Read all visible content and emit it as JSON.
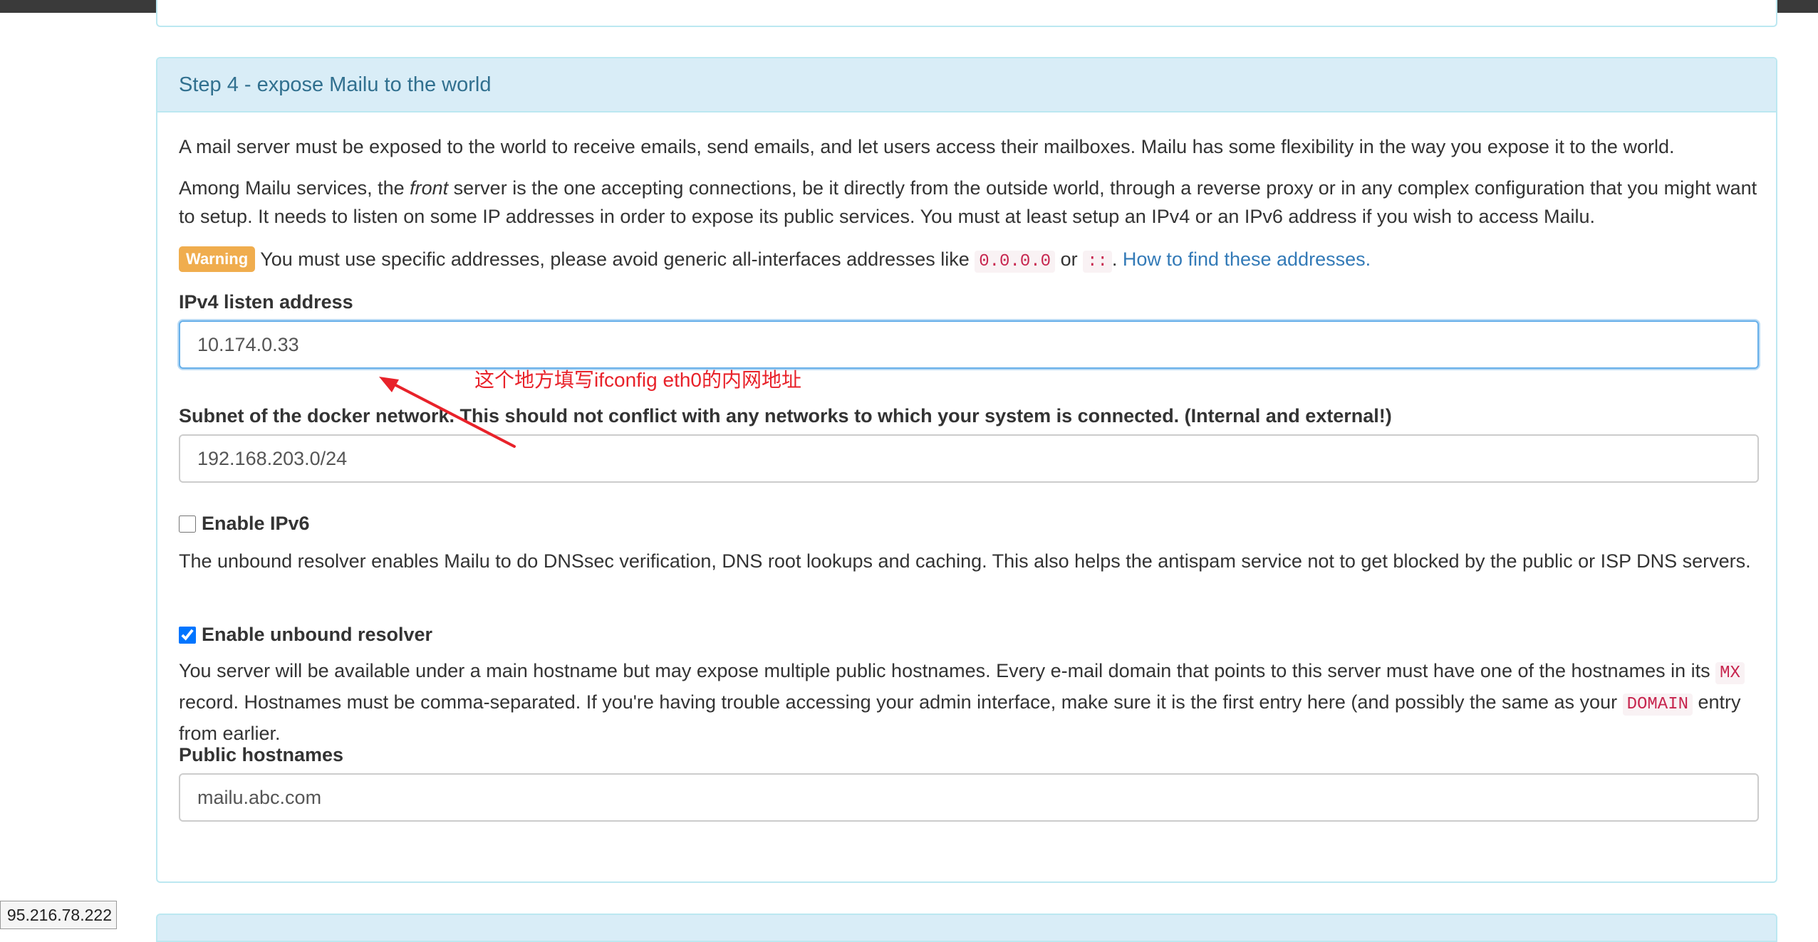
{
  "step": {
    "title": "Step 4 - expose Mailu to the world",
    "intro": "A mail server must be exposed to the world to receive emails, send emails, and let users access their mailboxes. Mailu has some flexibility in the way you expose it to the world.",
    "front_para": {
      "before": "Among Mailu services, the ",
      "em": "front",
      "after": " server is the one accepting connections, be it directly from the outside world, through a reverse proxy or in any complex configuration that you might want to setup. It needs to listen on some IP addresses in order to expose its public services. You must at least setup an IPv4 or an IPv6 address if you wish to access Mailu."
    },
    "warning": {
      "badge": "Warning",
      "text": " You must use specific addresses, please avoid generic all-interfaces addresses like ",
      "code1": "0.0.0.0",
      "or": " or ",
      "code2": "::",
      "dot": ". ",
      "link": "How to find these addresses."
    },
    "ipv4": {
      "label": "IPv4 listen address",
      "value": "10.174.0.33"
    },
    "subnet": {
      "label": "Subnet of the docker network. This should not conflict with any networks to which your system is connected. (Internal and external!)",
      "value": "192.168.203.0/24"
    },
    "ipv6": {
      "label": "Enable IPv6",
      "checked": false
    },
    "unbound_desc": "The unbound resolver enables Mailu to do DNSsec verification, DNS root lookups and caching. This also helps the antispam service not to get blocked by the public or ISP DNS servers.",
    "unbound": {
      "label": "Enable unbound resolver",
      "checked": true
    },
    "hostnames_desc": {
      "p1": "You server will be available under a main hostname but may expose multiple public hostnames. Every e-mail domain that points to this server must have one of the hostnames in its ",
      "code_mx": "MX",
      "p2": " record. Hostnames must be comma-separated. If you're having trouble accessing your admin interface, make sure it is the first entry here (and possibly the same as your ",
      "code_domain": "DOMAIN",
      "p3": " entry from earlier."
    },
    "hostnames": {
      "label": "Public hostnames",
      "value": "mailu.abc.com"
    }
  },
  "annotation": {
    "text": "这个地方填写ifconfig eth0的内网地址",
    "color": "#e8222a"
  },
  "tooltip": {
    "text": "95.216.78.222"
  },
  "colors": {
    "heading_bg": "#d9edf7",
    "heading_text": "#31708f",
    "border": "#bce8f1",
    "warning": "#f0ad4e",
    "link": "#337ab7",
    "code": "#c7254e"
  }
}
